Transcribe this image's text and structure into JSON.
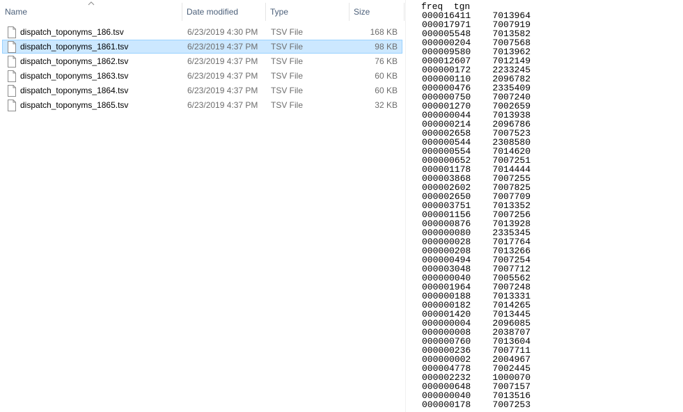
{
  "explorer": {
    "columns": {
      "name": "Name",
      "date_modified": "Date modified",
      "type": "Type",
      "size": "Size"
    },
    "files": [
      {
        "name": "dispatch_toponyms_186.tsv",
        "date": "6/23/2019 4:30 PM",
        "type": "TSV File",
        "size": "168 KB",
        "selected": false
      },
      {
        "name": "dispatch_toponyms_1861.tsv",
        "date": "6/23/2019 4:37 PM",
        "type": "TSV File",
        "size": "98 KB",
        "selected": true
      },
      {
        "name": "dispatch_toponyms_1862.tsv",
        "date": "6/23/2019 4:37 PM",
        "type": "TSV File",
        "size": "76 KB",
        "selected": false
      },
      {
        "name": "dispatch_toponyms_1863.tsv",
        "date": "6/23/2019 4:37 PM",
        "type": "TSV File",
        "size": "60 KB",
        "selected": false
      },
      {
        "name": "dispatch_toponyms_1864.tsv",
        "date": "6/23/2019 4:37 PM",
        "type": "TSV File",
        "size": "60 KB",
        "selected": false
      },
      {
        "name": "dispatch_toponyms_1865.tsv",
        "date": "6/23/2019 4:37 PM",
        "type": "TSV File",
        "size": "32 KB",
        "selected": false
      }
    ]
  },
  "text_panel": {
    "header": "freq  tgn",
    "lines": [
      "000016411    7013964",
      "000017971    7007919",
      "000005548    7013582",
      "000000204    7007568",
      "000009580    7013962",
      "000012607    7012149",
      "000000172    2233245",
      "000000110    2096782",
      "000000476    2335409",
      "000000750    7007240",
      "000001270    7002659",
      "000000044    7013938",
      "000000214    2096786",
      "000002658    7007523",
      "000000544    2308580",
      "000000554    7014620",
      "000000652    7007251",
      "000001178    7014444",
      "000003868    7007255",
      "000002602    7007825",
      "000002650    7007709",
      "000003751    7013352",
      "000001156    7007256",
      "000000876    7013928",
      "000000080    2335345",
      "000000028    7017764",
      "000000208    7013266",
      "000000494    7007254",
      "000003048    7007712",
      "000000040    7005562",
      "000001964    7007248",
      "000000188    7013331",
      "000000182    7014265",
      "000001420    7013445",
      "000000004    2096085",
      "000000008    2038707",
      "000000760    7013604",
      "000000236    7007711",
      "000000002    2004967",
      "000004778    7002445",
      "000002232    1000070",
      "000000648    7007157",
      "000000040    7013516",
      "000000178    7007253"
    ]
  }
}
